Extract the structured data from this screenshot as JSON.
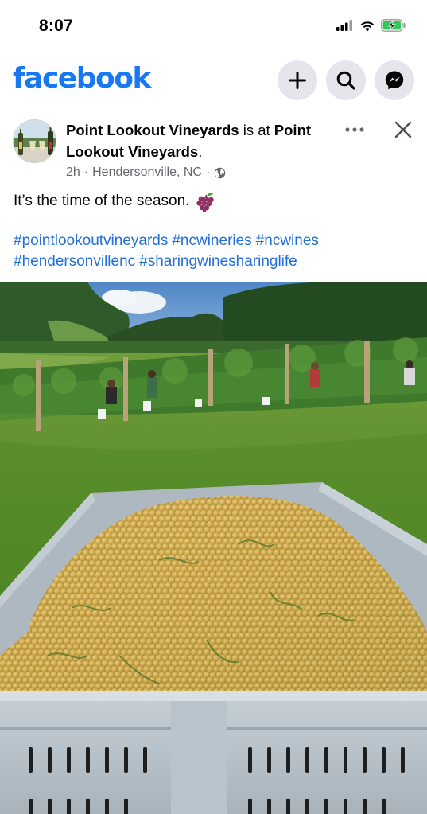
{
  "status_bar": {
    "time": "8:07",
    "icons": [
      "signal-icon",
      "wifi-icon",
      "battery-charging-icon"
    ]
  },
  "header": {
    "logo": "facebook",
    "brand_color": "#1877f2",
    "buttons": [
      "add-icon",
      "search-icon",
      "messenger-icon"
    ]
  },
  "post": {
    "page_name": "Point Lookout Vineyards",
    "connector": " is at ",
    "location_name": "Point Lookout Vineyards",
    "location_suffix": ".",
    "time_ago": "2h",
    "separator": "·",
    "place": "Hendersonville, NC",
    "audience_icon": "globe-icon",
    "text": "It’s the time of the season.",
    "text_emoji": "grapes-icon",
    "hashtags": [
      "#pointlookoutvineyards",
      "#ncwineries",
      "#ncwines",
      "#hendersonvillenc",
      "#sharingwinesharinglife"
    ],
    "hashtag_color": "#216fdb"
  }
}
